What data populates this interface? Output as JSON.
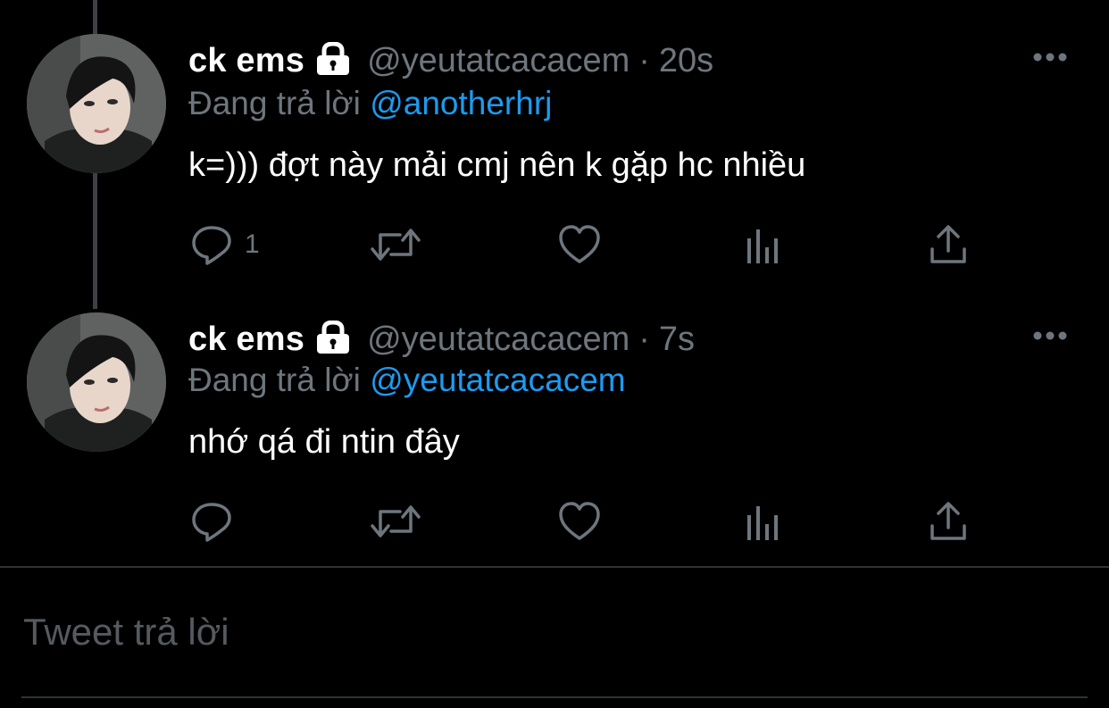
{
  "colors": {
    "background": "#000000",
    "text_primary": "#ffffff",
    "text_secondary": "#6e767d",
    "link": "#1d9bf0",
    "divider": "#2f3336"
  },
  "tweets": [
    {
      "display_name": "ck ems",
      "protected_icon": "lock-icon",
      "handle": "@yeutatcacacem",
      "separator": "·",
      "time": "20s",
      "replying_prefix": "Đang trả lời",
      "replying_to": "@anotherhrj",
      "text": "k=))) đợt này mải cmj nên k gặp hc nhiều",
      "reply_count": "1",
      "more_icon": "more-icon"
    },
    {
      "display_name": "ck ems",
      "protected_icon": "lock-icon",
      "handle": "@yeutatcacacem",
      "separator": "·",
      "time": "7s",
      "replying_prefix": "Đang trả lời",
      "replying_to": "@yeutatcacacem",
      "text": "nhớ qá đi ntin đây",
      "reply_count": "",
      "more_icon": "more-icon"
    }
  ],
  "action_icons": [
    "reply-icon",
    "retweet-icon",
    "like-icon",
    "views-icon",
    "share-icon"
  ],
  "composer": {
    "placeholder": "Tweet trả lời"
  }
}
